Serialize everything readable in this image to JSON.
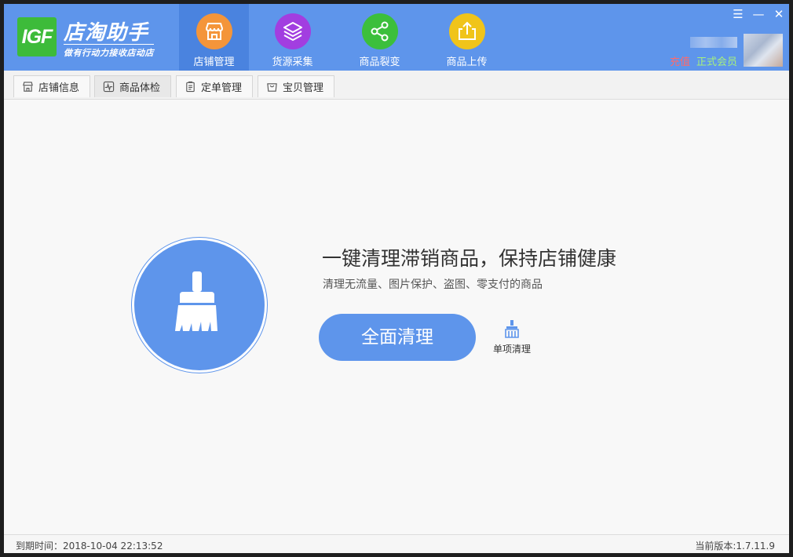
{
  "app": {
    "logo_mark": "IGF",
    "title": "店淘助手",
    "slogan": "做有行动力接收店动店"
  },
  "nav": [
    {
      "label": "店铺管理",
      "icon": "store-icon",
      "color": "#f4953a",
      "active": true
    },
    {
      "label": "货源采集",
      "icon": "layers-icon",
      "color": "#a23ee0",
      "active": false
    },
    {
      "label": "商品裂变",
      "icon": "share-icon",
      "color": "#3cbf3c",
      "active": false
    },
    {
      "label": "商品上传",
      "icon": "upload-icon",
      "color": "#f0c41a",
      "active": false
    }
  ],
  "window_controls": {
    "menu": "☰",
    "minimize": "—",
    "close": "✕"
  },
  "user": {
    "recharge": "充值",
    "member": "正式会员"
  },
  "tabs": [
    {
      "label": "店铺信息",
      "icon": "store-small-icon",
      "active": false
    },
    {
      "label": "商品体检",
      "icon": "pulse-icon",
      "active": true
    },
    {
      "label": "定单管理",
      "icon": "clipboard-icon",
      "active": false
    },
    {
      "label": "宝贝管理",
      "icon": "bag-icon",
      "active": false
    }
  ],
  "main": {
    "headline": "一键清理滞销商品，保持店铺健康",
    "subline": "清理无流量、图片保护、盗图、零支付的商品",
    "clean_all": "全面清理",
    "single_clean": "单项清理"
  },
  "footer": {
    "expiry": "到期时间：2018-10-04 22:13:52",
    "version": "当前版本:1.7.11.9"
  },
  "colors": {
    "header": "#5e95eb",
    "nav_active": "#4a83df",
    "accent": "#5e95eb",
    "recharge": "#ff6a6a",
    "member": "#a7f07d"
  }
}
